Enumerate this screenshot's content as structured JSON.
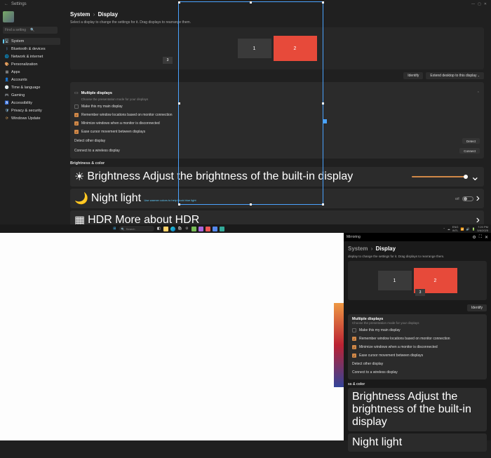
{
  "titlebar": {
    "title": "Settings"
  },
  "search": {
    "placeholder": "Find a setting"
  },
  "nav": [
    {
      "icon": "🖥️",
      "label": "System",
      "color": "#60cdff",
      "active": true
    },
    {
      "icon": "ᛒ",
      "label": "Bluetooth & devices",
      "color": "#6aa0e0"
    },
    {
      "icon": "🌐",
      "label": "Network & internet",
      "color": "#6aa0e0"
    },
    {
      "icon": "🎨",
      "label": "Personalization",
      "color": "#b77"
    },
    {
      "icon": "▦",
      "label": "Apps",
      "color": "#aaa"
    },
    {
      "icon": "👤",
      "label": "Accounts",
      "color": "#cba"
    },
    {
      "icon": "🕓",
      "label": "Time & language",
      "color": "#aaa"
    },
    {
      "icon": "🎮",
      "label": "Gaming",
      "color": "#7c7"
    },
    {
      "icon": "♿",
      "label": "Accessibility",
      "color": "#8bd"
    },
    {
      "icon": "🛡",
      "label": "Privacy & security",
      "color": "#8bd"
    },
    {
      "icon": "⟳",
      "label": "Windows Update",
      "color": "#e9a95a"
    }
  ],
  "breadcrumb": {
    "root": "System",
    "page": "Display"
  },
  "subtitle": "Select a display to change the settings for it. Drag displays to rearrange them.",
  "monitors": {
    "m1": "1",
    "m2": "2",
    "m3": "3"
  },
  "buttons": {
    "identify": "Identify",
    "extend": "Extend desktop to this display"
  },
  "multi": {
    "title": "Multiple displays",
    "sub": "Choose the presentation mode for your displays",
    "opts": [
      {
        "label": "Make this my main display",
        "checked": false
      },
      {
        "label": "Remember window locations based on monitor connection",
        "checked": true
      },
      {
        "label": "Minimize windows when a monitor is disconnected",
        "checked": true
      },
      {
        "label": "Ease cursor movement between displays",
        "checked": true
      }
    ],
    "detect": {
      "label": "Detect other display",
      "btn": "Detect"
    },
    "wireless": {
      "label": "Connect to a wireless display",
      "btn": "Connect"
    }
  },
  "bc_section": "Brightness & color",
  "brightness": {
    "title": "Brightness",
    "sub": "Adjust the brightness of the built-in display",
    "value": 95
  },
  "nightlight": {
    "title": "Night light",
    "sub": "Use warmer colors to help block blue light",
    "state": "Off"
  },
  "hdr": {
    "title": "HDR",
    "sub": "More about HDR"
  },
  "taskbar": {
    "search": "Search",
    "time": "7:20 PM",
    "date": "5/6/2025",
    "lang": "ENG",
    "kb": "INTL"
  },
  "mirror": {
    "title": "Mirroring"
  }
}
